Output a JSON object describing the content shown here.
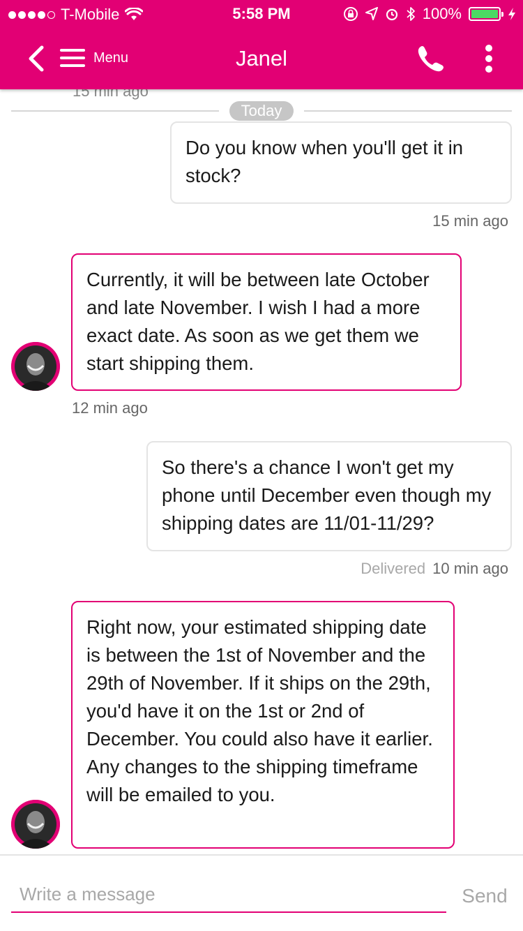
{
  "status_bar": {
    "carrier": "T-Mobile",
    "time": "5:58 PM",
    "battery": "100%",
    "signal_bars_filled": 4,
    "signal_bars_total": 5
  },
  "header": {
    "menu_label": "Menu",
    "title": "Janel"
  },
  "chat": {
    "cut_timestamp": "15 min ago",
    "date_divider": "Today",
    "messages": [
      {
        "direction": "outgoing",
        "text": "Do you know when you'll get it in stock?",
        "timestamp": "15 min ago"
      },
      {
        "direction": "incoming",
        "text": "Currently, it will be between late October and late November. I wish I had a more exact date. As soon as we get them we start shipping them.",
        "timestamp": "12 min ago"
      },
      {
        "direction": "outgoing",
        "text": "So there's a chance I won't get my phone until December even though my shipping dates are 11/01-11/29?",
        "status": "Delivered",
        "timestamp": "10 min ago"
      },
      {
        "direction": "incoming",
        "text": "Right now, your estimated shipping date is between the 1st of November and the 29th of November. If it ships on the 29th, you'd have it on the 1st or 2nd of December. You could also have it earlier. Any changes to the shipping timeframe will be emailed to you."
      }
    ]
  },
  "composer": {
    "placeholder": "Write a message",
    "send_label": "Send"
  },
  "colors": {
    "brand": "#e20074",
    "battery_fill": "#4cd964",
    "divider_pill": "#c6c6c6",
    "muted_text": "#a8a8a8"
  },
  "icons": [
    "back-chevron-icon",
    "hamburger-icon",
    "phone-icon",
    "more-vertical-icon",
    "wifi-icon",
    "rotation-lock-icon",
    "location-icon",
    "alarm-icon",
    "bluetooth-icon",
    "battery-icon",
    "charging-icon",
    "avatar"
  ]
}
